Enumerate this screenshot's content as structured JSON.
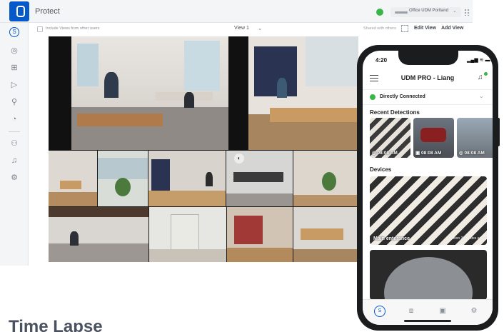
{
  "app": {
    "title": "Protect"
  },
  "header": {
    "console_name": "Office UDM Portland",
    "console_chevron": "⌄",
    "status_color": "#39b54a"
  },
  "toolbar": {
    "include_label": "Include Views from other users",
    "view_label": "View 1",
    "view_chevron": "⌄",
    "shared_label": "Shared with others",
    "edit_label": "Edit View",
    "add_label": "Add View"
  },
  "sidebar": {
    "items": [
      {
        "icon": "protect-logo-icon",
        "glyph": "S",
        "active": true
      },
      {
        "icon": "camera-icon",
        "glyph": "◎"
      },
      {
        "icon": "grid-icon",
        "glyph": "⊞"
      },
      {
        "icon": "play-icon",
        "glyph": "▷"
      },
      {
        "icon": "detection-icon",
        "glyph": "⚲"
      },
      {
        "icon": "timelapse-icon",
        "glyph": "◔"
      },
      {
        "icon": "users-icon",
        "glyph": "⚇"
      },
      {
        "icon": "bell-icon",
        "glyph": "♫"
      },
      {
        "icon": "settings-icon",
        "glyph": "⚙"
      }
    ]
  },
  "mic_badge": "◐",
  "page": {
    "heading": "Time Lapse"
  },
  "phone": {
    "time": "4:20",
    "signal": "▂▄▆ ≋ ▬",
    "title": "UDM PRO - Liang",
    "connection": "Directly Connected",
    "connection_chevron": "⌄",
    "recent_heading": "Recent Detections",
    "detections": [
      {
        "time": "08:08 AM",
        "glyph": "◎"
      },
      {
        "time": "08:08 AM",
        "glyph": "▣"
      },
      {
        "time": "08:08 AM",
        "glyph": "◎"
      }
    ],
    "devices_heading": "Devices",
    "devices": [
      {
        "name": "Main enterance",
        "status": "Motion 3 minutes ago"
      }
    ],
    "tabs": [
      {
        "icon": "protect-tab-icon",
        "glyph": "S",
        "active": true
      },
      {
        "icon": "devices-tab-icon",
        "glyph": "⧈"
      },
      {
        "icon": "timeline-tab-icon",
        "glyph": "▣"
      },
      {
        "icon": "settings-tab-icon",
        "glyph": "⚙"
      }
    ]
  },
  "colors": {
    "accent": "#0559c9",
    "online": "#39b54a"
  }
}
